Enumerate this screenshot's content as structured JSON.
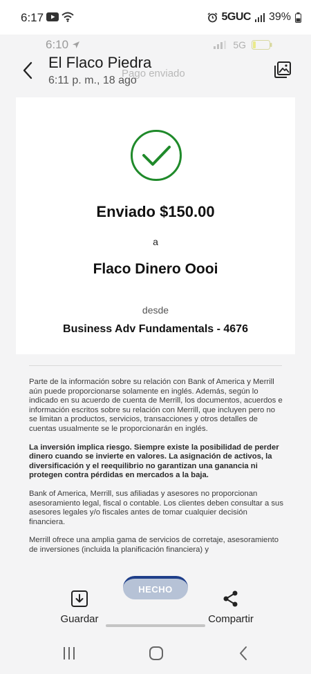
{
  "system_status": {
    "time": "6:17",
    "network": "5GUC",
    "battery": "39%",
    "icons": [
      "youtube-icon",
      "wifi-icon",
      "alarm-icon",
      "signal-icon",
      "battery-icon"
    ]
  },
  "inner_status": {
    "time": "6:10",
    "network": "5G",
    "icons": [
      "location-arrow-icon",
      "signal-icon",
      "battery-icon"
    ]
  },
  "header": {
    "title": "El Flaco Piedra",
    "subtitle": "6:11 p. m., 18 ago",
    "faded_status": "Pago enviado",
    "icons": [
      "chevron-left-icon",
      "gallery-icon"
    ]
  },
  "receipt": {
    "status_line": "Enviado $150.00",
    "to_word": "a",
    "recipient": "Flaco Dinero Oooi",
    "from_word": "desde",
    "account": "Business Adv Fundamentals - 4676",
    "status_icon": "check-circle-icon",
    "accent_color": "#1f8a2a"
  },
  "disclosure": {
    "paragraphs": [
      "Parte de la información sobre su relación con Bank of America y Merrill aún puede proporcionarse solamente en inglés. Además, según lo indicado en su acuerdo de cuenta de Merrill, los documentos, acuerdos e información escritos sobre su relación con Merrill, que incluyen pero no se limitan a productos, servicios, transacciones y otros detalles de cuentas usualmente se le proporcionarán en inglés.",
      "La inversión implica riesgo. Siempre existe la posibilidad de perder dinero cuando se invierte en valores. La asignación de activos, la diversificación y el reequilibrio no garantizan una ganancia ni protegen contra pérdidas en mercados a la baja.",
      "Bank of America, Merrill, sus afiliadas y asesores no proporcionan asesoramiento legal, fiscal o contable. Los clientes deben consultar a sus asesores legales y/o fiscales antes de tomar cualquier decisión financiera.",
      "Merrill ofrece una amplia gama de servicios de corretaje, asesoramiento de inversiones (incluida la planificación financiera) y"
    ]
  },
  "actions": {
    "done_label": "HECHO",
    "save_label": "Guardar",
    "share_label": "Compartir",
    "icons": [
      "download-icon",
      "share-icon"
    ]
  },
  "nav_bar": {
    "icons": [
      "recents-icon",
      "home-icon",
      "back-icon"
    ]
  }
}
